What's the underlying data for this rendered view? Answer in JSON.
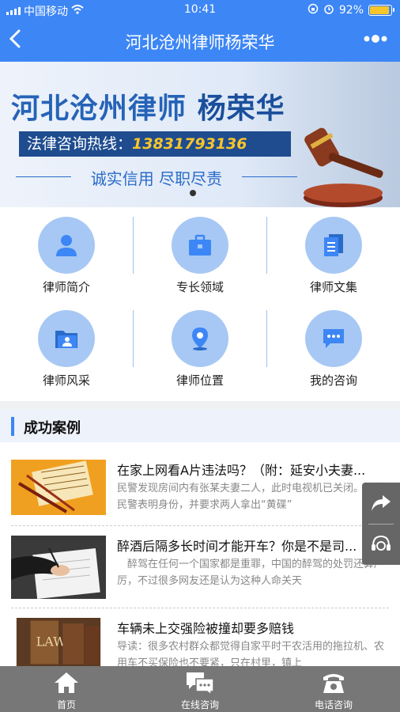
{
  "status_bar": {
    "carrier": "中国移动",
    "time": "10:41",
    "battery": "92%"
  },
  "nav": {
    "title": "河北沧州律师杨荣华",
    "back_icon": "chevron-left-icon",
    "more_icon": "more-dots-icon"
  },
  "banner": {
    "headline_a": "河北沧州律师",
    "headline_b": "杨荣华",
    "hotline_label": "法律咨询热线：",
    "hotline_number": "13831793136",
    "slogan": "诚实信用 尽职尽责"
  },
  "grid": [
    {
      "label": "律师简介",
      "icon": "person-icon"
    },
    {
      "label": "专长领域",
      "icon": "briefcase-icon"
    },
    {
      "label": "律师文集",
      "icon": "documents-icon"
    },
    {
      "label": "律师风采",
      "icon": "folder-user-icon"
    },
    {
      "label": "律师位置",
      "icon": "location-pin-icon"
    },
    {
      "label": "我的咨询",
      "icon": "chat-bubble-icon"
    }
  ],
  "section": {
    "title": "成功案例"
  },
  "cases": [
    {
      "title": "在家上网看A片违法吗？（附：延安小夫妻...",
      "desc": "民警发现房间内有张某夫妻二人，此时电视机已关闭。几名民警表明身份，并要求两人拿出“黄碟”"
    },
    {
      "title": "醉酒后隔多长时间才能开车？你是不是司...",
      "desc": "　醉驾在任何一个国家都是重罪，中国的醉驾的处罚还算严厉，不过很多网友还是认为这种人命关天"
    },
    {
      "title": "车辆未上交强险被撞却要多赔钱",
      "desc": "导读：很多农村群众都觉得自家平时干农活用的拖拉机、农用车不买保险也不要紧，只在村里，镇上"
    }
  ],
  "tabbar": [
    {
      "label": "首页",
      "icon": "home-icon"
    },
    {
      "label": "在线咨询",
      "icon": "chat-icon"
    },
    {
      "label": "电话咨询",
      "icon": "telephone-icon"
    }
  ],
  "float_buttons": {
    "share_icon": "share-icon",
    "service_icon": "customer-service-icon"
  },
  "colors": {
    "primary": "#3d86f5",
    "icon_circle": "#a7c8f4",
    "tabbar": "#777777"
  }
}
